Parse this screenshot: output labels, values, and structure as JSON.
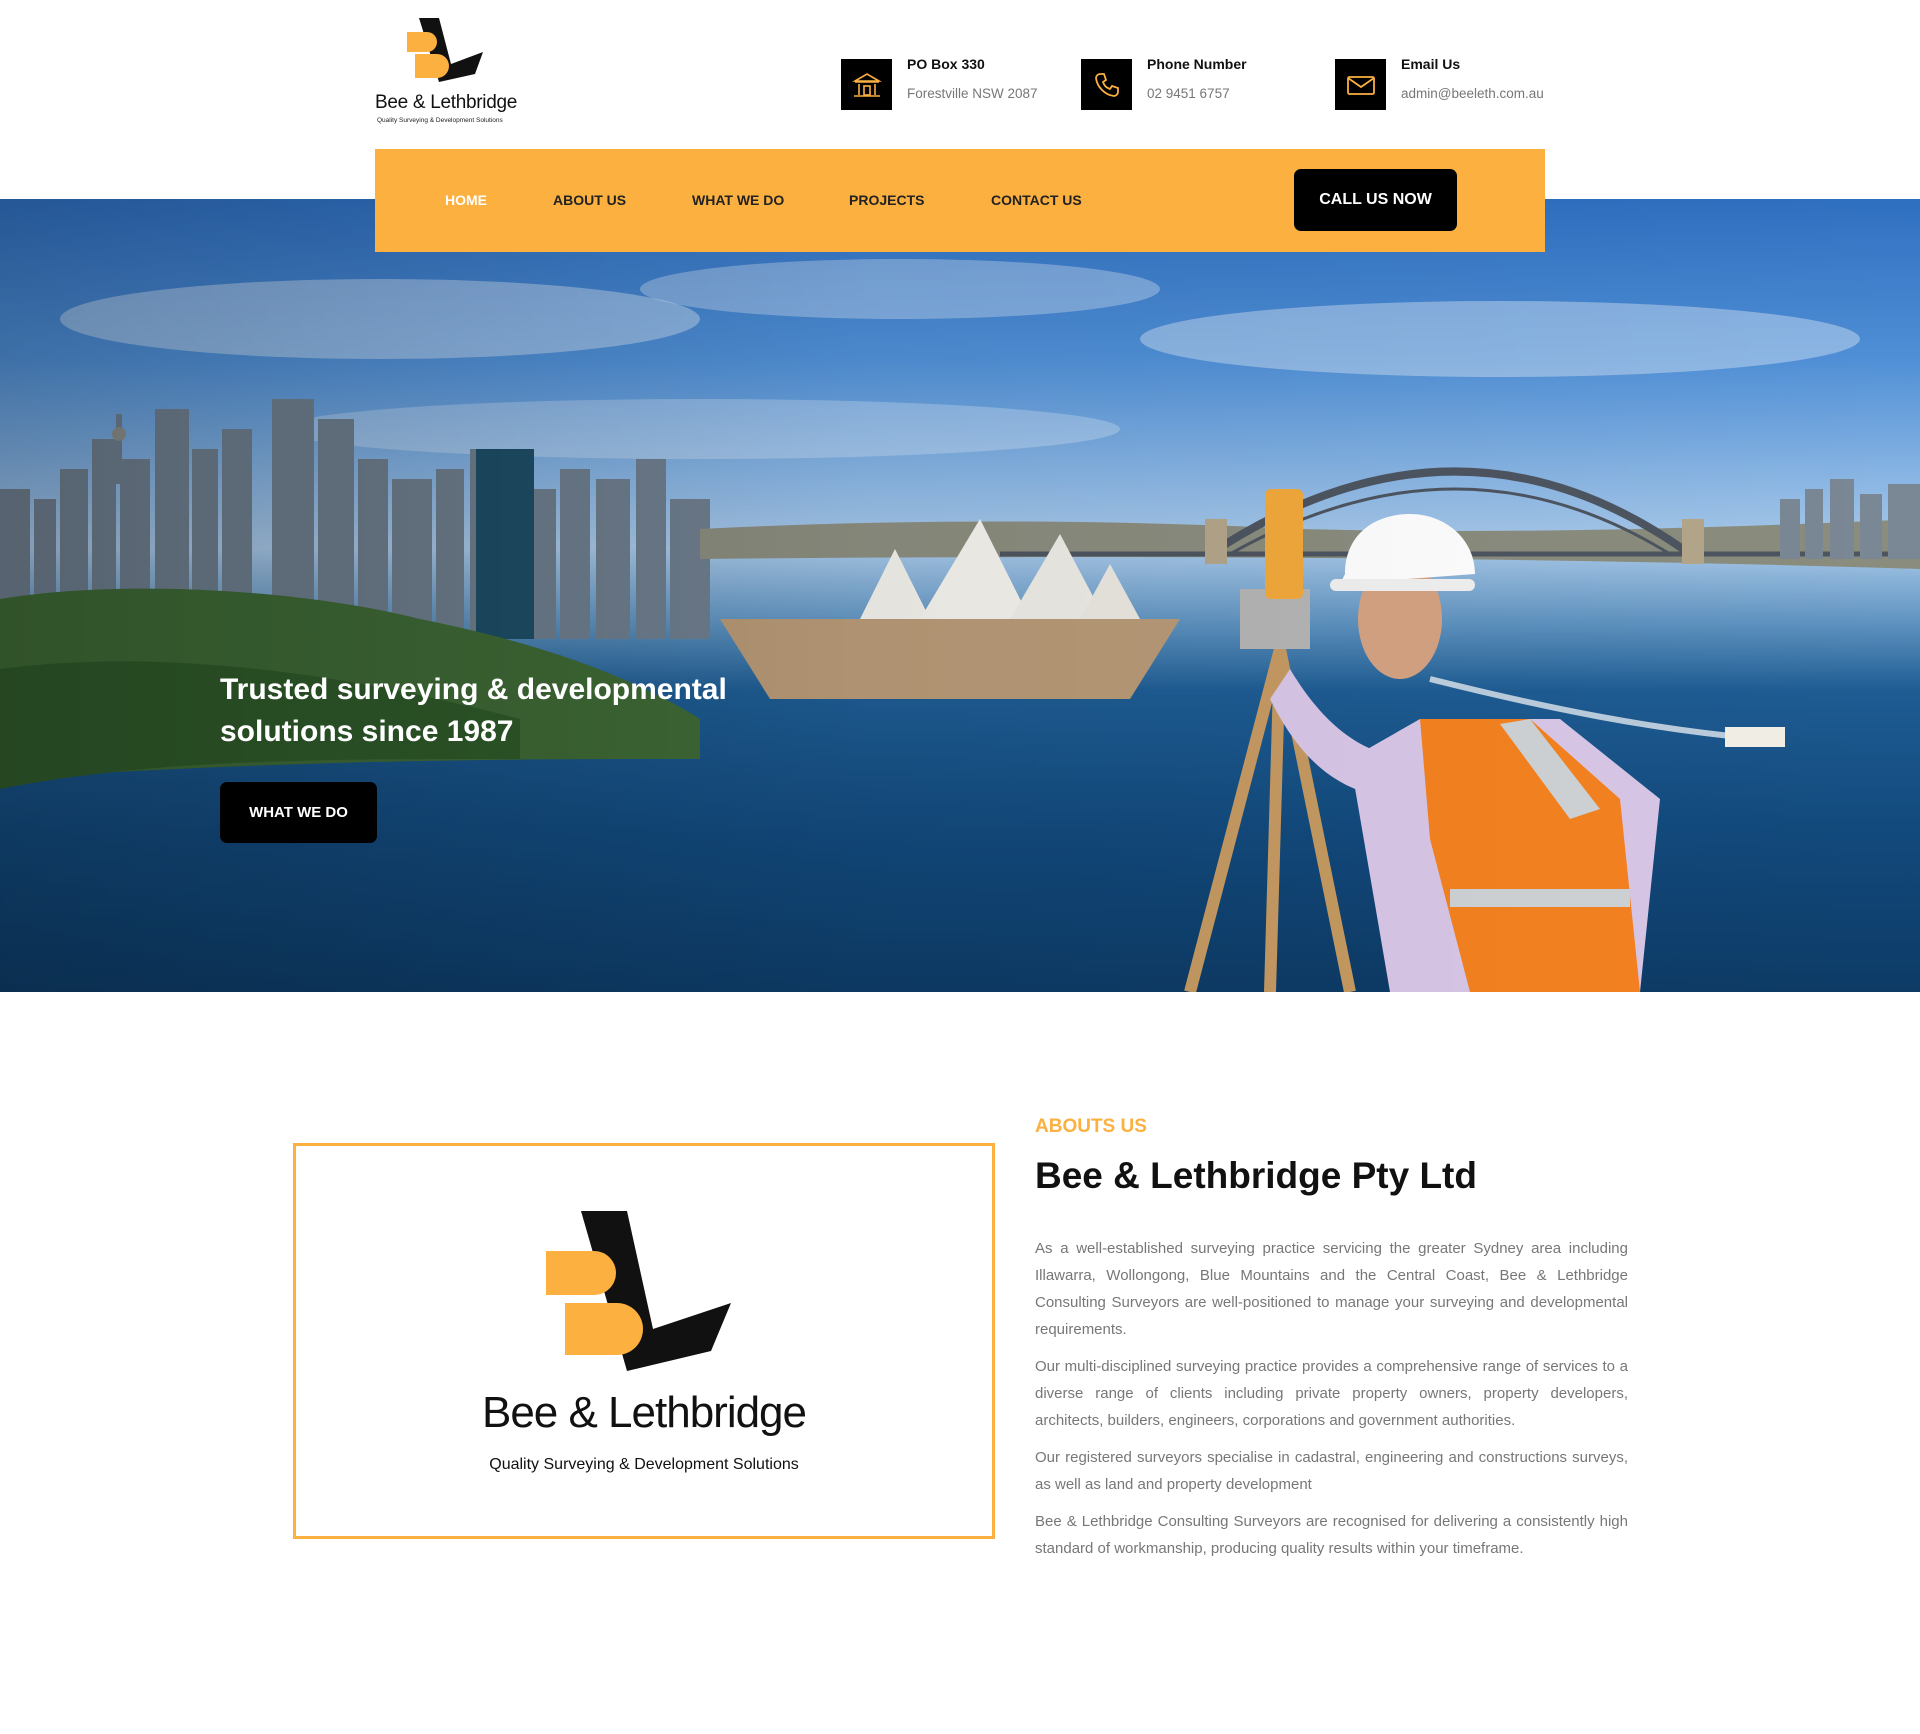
{
  "brand": {
    "name": "Bee & Lethbridge",
    "tagline": "Quality Surveying & Development Solutions"
  },
  "colors": {
    "accent": "#fbb040",
    "dark": "#000000",
    "muted_text": "#777777"
  },
  "contacts": [
    {
      "icon": "building-icon",
      "label": "PO Box 330",
      "value": "Forestville NSW 2087"
    },
    {
      "icon": "phone-icon",
      "label": "Phone Number",
      "value": "02 9451 6757"
    },
    {
      "icon": "envelope-icon",
      "label": "Email Us",
      "value": "admin@beeleth.com.au"
    }
  ],
  "nav": {
    "items": [
      "HOME",
      "ABOUT US",
      "WHAT WE DO",
      "PROJECTS",
      "CONTACT US"
    ],
    "active": "HOME",
    "cta": "CALL US NOW"
  },
  "hero": {
    "title": "Trusted surveying & developmental solutions since 1987",
    "button": "WHAT WE DO"
  },
  "about": {
    "kicker": "ABOUTS US",
    "title": "Bee & Lethbridge Pty Ltd",
    "paragraphs": [
      "As a well-established surveying practice servicing the greater Sydney area including Illawarra, Wollongong, Blue Mountains and the Central Coast, Bee & Lethbridge Consulting Surveyors are well-positioned to manage your surveying and developmental requirements.",
      "Our multi-disciplined surveying practice provides a comprehensive range of services to a diverse range of clients including private property owners, property developers, architects, builders, engineers, corporations and government authorities.",
      "Our registered surveyors specialise in cadastral, engineering and constructions surveys, as well as land and property development",
      "Bee & Lethbridge Consulting Surveyors are recognised for delivering a consistently high standard of workmanship, producing quality results within your timeframe."
    ]
  }
}
